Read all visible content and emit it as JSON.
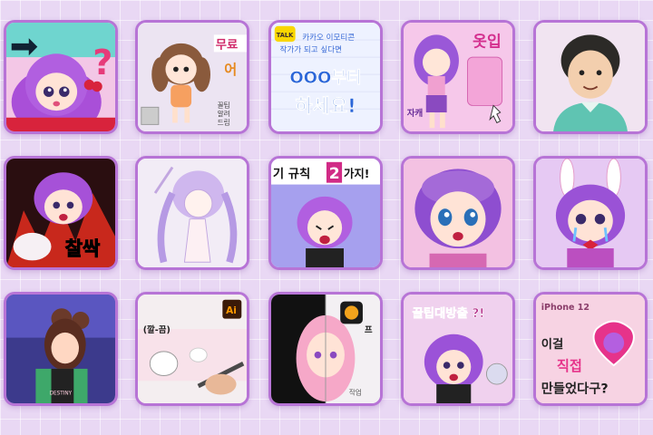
{
  "thumbnails": [
    {
      "id": 1,
      "row": 1,
      "col": 1,
      "subject": "purple-haired chibi girl with question mark and arrow"
    },
    {
      "id": 2,
      "row": 1,
      "col": 2,
      "text": [
        "무료",
        "어",
        "꿀팁",
        "알려",
        "드림"
      ]
    },
    {
      "id": 3,
      "row": 1,
      "col": 3,
      "badge": "TALK",
      "text": [
        "카카오 이모티콘",
        "작가가 되고 싶다면",
        "OOO부터",
        "하세요!"
      ]
    },
    {
      "id": 4,
      "row": 1,
      "col": 4,
      "text": [
        "옷입",
        "자캐"
      ]
    },
    {
      "id": 5,
      "row": 1,
      "col": 5,
      "subject": "dark-haired man portrait on mint background"
    },
    {
      "id": 6,
      "row": 2,
      "col": 1,
      "text": [
        "찰싹"
      ]
    },
    {
      "id": 7,
      "row": 2,
      "col": 2,
      "subject": "lavender-haired girl line art sketch"
    },
    {
      "id": 8,
      "row": 2,
      "col": 3,
      "text": [
        "기 규칙",
        "2",
        "가지!"
      ]
    },
    {
      "id": 9,
      "row": 2,
      "col": 4,
      "subject": "purple-haired girl close-up surprised"
    },
    {
      "id": 10,
      "row": 2,
      "col": 5,
      "subject": "purple-haired girl with bunny ears crying"
    },
    {
      "id": 11,
      "row": 3,
      "col": 1,
      "subject": "anime girl with buns on neon background",
      "text": [
        "DESTINY"
      ]
    },
    {
      "id": 12,
      "row": 3,
      "col": 2,
      "badge": "Ai",
      "text": [
        "(깔-끔)"
      ]
    },
    {
      "id": 13,
      "row": 3,
      "col": 3,
      "text": [
        "프",
        "작업"
      ]
    },
    {
      "id": 14,
      "row": 3,
      "col": 4,
      "text": [
        "꿀팁대방출 ?!"
      ]
    },
    {
      "id": 15,
      "row": 3,
      "col": 5,
      "text": [
        "iPhone 12",
        "이걸",
        "직접",
        "만들었다구?"
      ]
    }
  ],
  "colors": {
    "border": "#b774d6",
    "background": "#e9d8f4",
    "accent": "#e64aa0"
  }
}
